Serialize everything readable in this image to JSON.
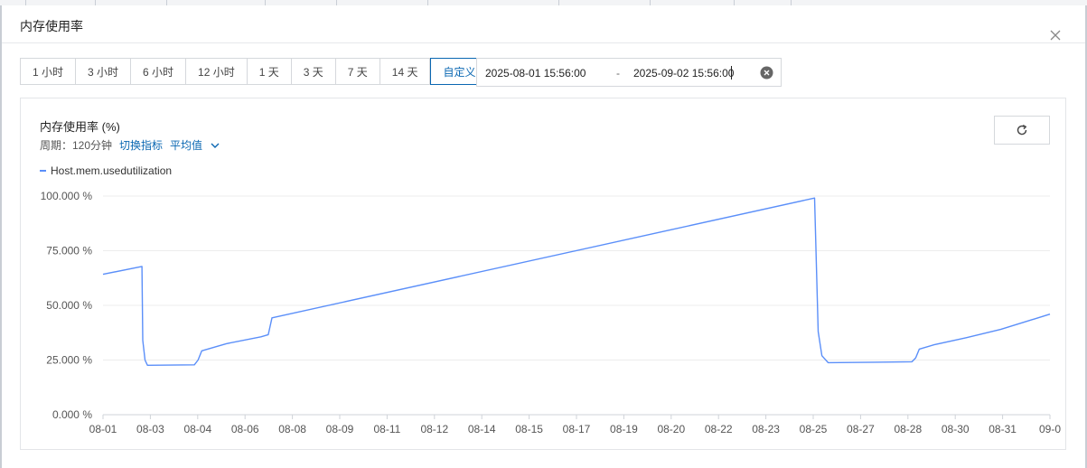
{
  "dialog": {
    "title": "内存使用率"
  },
  "time_ranges": [
    "1 小时",
    "3 小时",
    "6 小时",
    "12 小时",
    "1 天",
    "3 天",
    "7 天",
    "14 天",
    "自定义"
  ],
  "active_range_index": 8,
  "date_range": {
    "start": "2025-08-01 15:56:00",
    "separator": "-",
    "end": "2025-09-02 15:56:00"
  },
  "chart_header": {
    "title": "内存使用率 (%)",
    "period_label": "周期：120分钟",
    "switch_metric": "切换指标",
    "aggregation": "平均值"
  },
  "colors": {
    "accent": "#0a67b2",
    "series": "#5b8ff9",
    "grid": "#ececec"
  },
  "icons": {
    "close": "close-icon",
    "clear": "clear-icon",
    "refresh": "refresh-icon",
    "dropdown": "chevron-down-icon"
  },
  "chart_data": {
    "type": "line",
    "title": "内存使用率 (%)",
    "x_tick_labels": [
      "08-01",
      "08-03",
      "08-04",
      "08-06",
      "08-08",
      "08-09",
      "08-11",
      "08-12",
      "08-14",
      "08-15",
      "08-17",
      "08-19",
      "08-20",
      "08-22",
      "08-23",
      "08-25",
      "08-27",
      "08-28",
      "08-30",
      "08-31",
      "09-0"
    ],
    "y_tick_labels": [
      "100.000 %",
      "75.000 %",
      "50.000 %",
      "25.000 %",
      "0.000 %"
    ],
    "ylim": [
      0,
      100
    ],
    "x_range": [
      "2025-08-01 15:56",
      "2025-09-02 15:56"
    ],
    "grid": true,
    "legend_position": "top-left",
    "series": [
      {
        "name": "Host.mem.usedutilization",
        "points": [
          [
            "2025-08-01 15:56",
            64.2
          ],
          [
            "2025-08-02 23:30",
            67.8
          ],
          [
            "2025-08-03 00:10",
            34
          ],
          [
            "2025-08-03 02:00",
            25
          ],
          [
            "2025-08-03 04:00",
            22.6
          ],
          [
            "2025-08-04 18:00",
            22.8
          ],
          [
            "2025-08-04 21:00",
            25
          ],
          [
            "2025-08-05 00:00",
            29.2
          ],
          [
            "2025-08-05 20:00",
            32.5
          ],
          [
            "2025-08-07 00:00",
            35.6
          ],
          [
            "2025-08-07 06:00",
            36.6
          ],
          [
            "2025-08-07 09:00",
            44.3
          ],
          [
            "2025-08-25 17:00",
            99.1
          ],
          [
            "2025-08-25 20:00",
            38
          ],
          [
            "2025-08-25 23:00",
            27
          ],
          [
            "2025-08-26 04:00",
            23.8
          ],
          [
            "2025-08-27 18:00",
            24
          ],
          [
            "2025-08-29 00:00",
            24.2
          ],
          [
            "2025-08-29 03:00",
            26
          ],
          [
            "2025-08-29 06:00",
            30
          ],
          [
            "2025-08-29 18:00",
            32
          ],
          [
            "2025-08-30 20:00",
            35.2
          ],
          [
            "2025-09-01 00:00",
            39
          ],
          [
            "2025-09-02 15:56",
            46
          ]
        ]
      }
    ]
  }
}
